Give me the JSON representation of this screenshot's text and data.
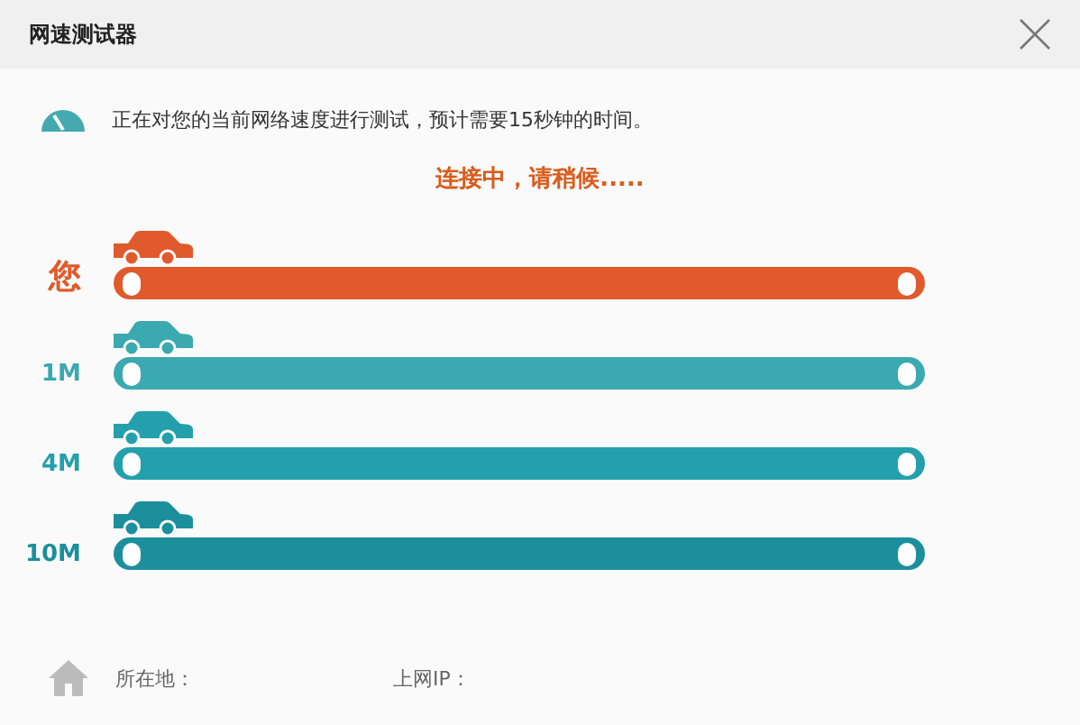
{
  "window": {
    "title": "网速测试器"
  },
  "info": {
    "text": "正在对您的当前网络速度进行测试，预计需要15秒钟的时间。"
  },
  "status": "连接中，请稍候.....",
  "lanes": [
    {
      "label": "您",
      "color": "#e05a2b"
    },
    {
      "label": "1M",
      "color": "#3aa9b0"
    },
    {
      "label": "4M",
      "color": "#23a0ab"
    },
    {
      "label": "10M",
      "color": "#1b8f9c"
    }
  ],
  "footer": {
    "location_label": "所在地：",
    "ip_label": "上网IP："
  }
}
